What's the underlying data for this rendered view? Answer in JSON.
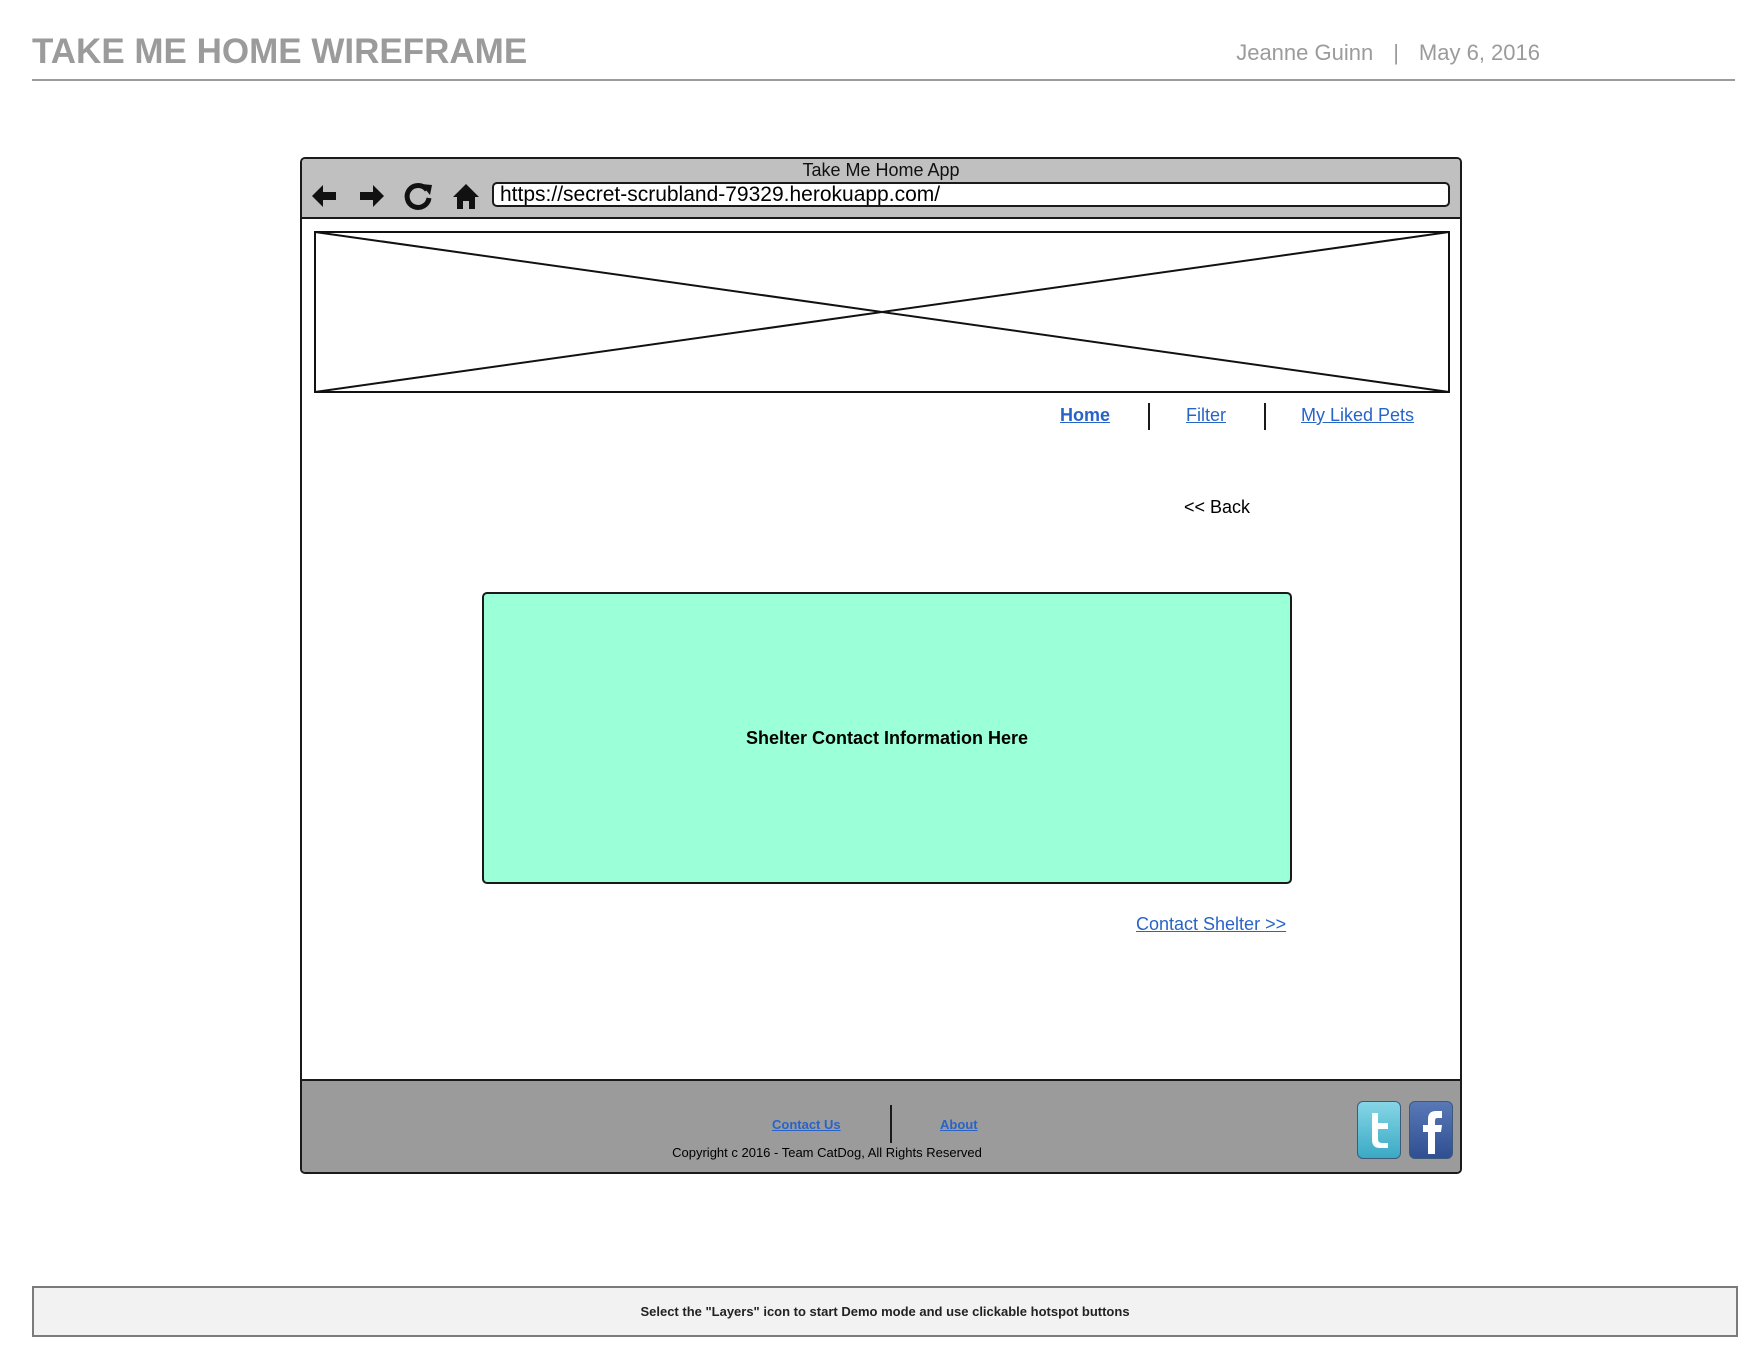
{
  "header": {
    "title": "TAKE ME HOME WIREFRAME",
    "author": "Jeanne Guinn",
    "separator": "|",
    "date": "May 6, 2016"
  },
  "browser": {
    "title": "Take Me Home App",
    "url": "https://secret-scrubland-79329.herokuapp.com/",
    "icons": [
      "back-arrow-icon",
      "forward-arrow-icon",
      "reload-icon",
      "home-icon"
    ]
  },
  "nav": {
    "items": [
      {
        "label": "Home",
        "active": true
      },
      {
        "label": "Filter",
        "active": false
      },
      {
        "label": "My Liked Pets",
        "active": false
      }
    ]
  },
  "main": {
    "back_label": "<< Back",
    "shelter_info": "Shelter Contact Information Here",
    "contact_link": "Contact Shelter >>",
    "shelter_box_color": "#9bffd8"
  },
  "footer": {
    "links": [
      "Contact Us",
      "About"
    ],
    "copyright": "Copyright c 2016 -  Team CatDog, All Rights Reserved",
    "social_icons": [
      "twitter-icon",
      "facebook-icon"
    ],
    "background_color": "#9b9b9b"
  },
  "note": "Select the \"Layers\" icon to start Demo mode and use clickable hotspot buttons",
  "colors": {
    "link": "#2864c8",
    "header_text": "#9b9b9b",
    "toolbar": "#c0c0c0"
  }
}
